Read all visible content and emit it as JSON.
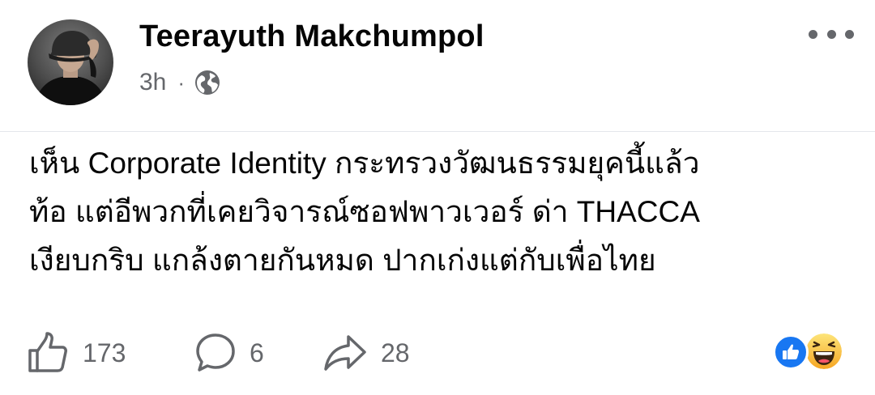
{
  "post": {
    "author_name": "Teerayuth Makchumpol",
    "time_ago": "3h",
    "separator": "·",
    "audience_icon": "globe-icon",
    "more_icon": "more-horizontal-icon",
    "text_lines": [
      "เห็น Corporate Identity กระทรวงวัฒนธรรมยุคนี้แล้ว",
      "ท้อ แต่อีพวกที่เคยวิจารณ์ซอฟพาวเวอร์ ด่า THACCA",
      "เงียบกริบ แกล้งตายกันหมด ปากเก่งแต่กับเพื่อไทย"
    ]
  },
  "actions": {
    "like": {
      "icon": "thumbs-up-outline-icon",
      "count": "173"
    },
    "comment": {
      "icon": "comment-bubble-icon",
      "count": "6"
    },
    "share": {
      "icon": "share-arrow-icon",
      "count": "28"
    }
  },
  "reactions": [
    {
      "icon": "like-reaction-icon",
      "color": "#1877f2"
    },
    {
      "icon": "haha-reaction-icon",
      "color": "#f7b125"
    }
  ],
  "colors": {
    "text_primary": "#050505",
    "text_secondary": "#65676b",
    "divider": "#e4e6eb",
    "brand_blue": "#1877f2"
  }
}
